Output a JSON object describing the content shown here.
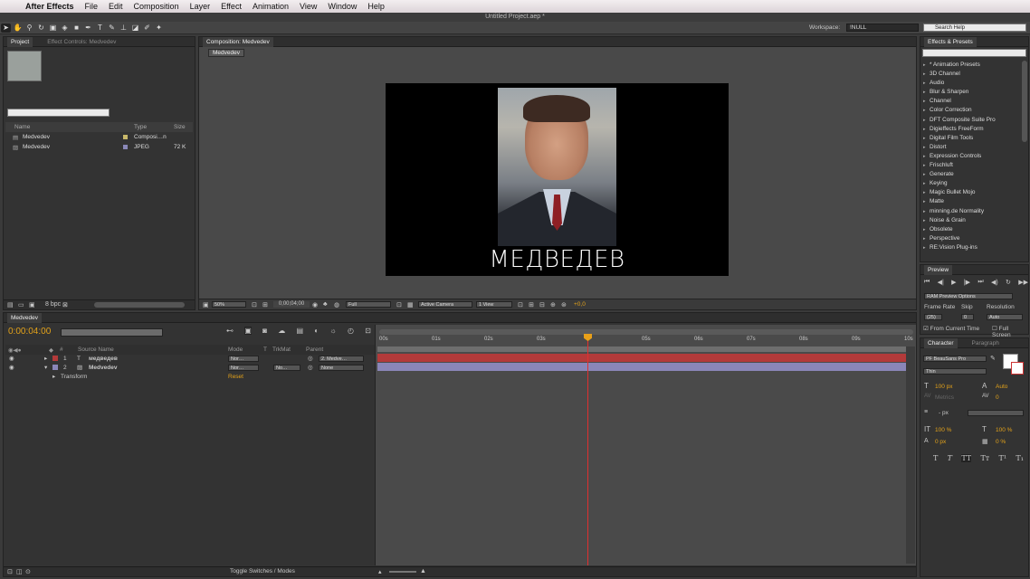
{
  "menu": {
    "app": "After Effects",
    "items": [
      "File",
      "Edit",
      "Composition",
      "Layer",
      "Effect",
      "Animation",
      "View",
      "Window",
      "Help"
    ]
  },
  "window_title": "Untitled Project.aep *",
  "workspace": {
    "label": "Workspace:",
    "value": "!NULL"
  },
  "search_help": "Search Help",
  "project": {
    "tab": "Project",
    "effect_controls_tab": "Effect Controls: Medvedev",
    "columns": {
      "name": "Name",
      "type": "Type",
      "size": "Size"
    },
    "items": [
      {
        "name": "Medvedev",
        "type": "Composi…n",
        "size": ""
      },
      {
        "name": "Medvedev",
        "type": "JPEG",
        "size": "72 K"
      }
    ],
    "bpc": "8 bpc"
  },
  "composition": {
    "tab": "Composition: Medvedev",
    "sub_tab": "Medvedev",
    "caption": "МЕДВЕДЕВ",
    "footer": {
      "zoom": "50%",
      "time": "0;00;04;00",
      "resolution": "Full",
      "camera": "Active Camera",
      "view": "1 View",
      "exposure": "+0,0"
    }
  },
  "effects": {
    "tab": "Effects & Presets",
    "items": [
      "* Animation Presets",
      "3D Channel",
      "Audio",
      "Blur & Sharpen",
      "Channel",
      "Color Correction",
      "DFT Composite Suite Pro",
      "Digieffects FreeForm",
      "Digital Film Tools",
      "Distort",
      "Expression Controls",
      "Frischluft",
      "Generate",
      "Keying",
      "Magic Bullet Mojo",
      "Matte",
      "minning.de Normality",
      "Noise & Grain",
      "Obsolete",
      "Perspective",
      "RE:Vision Plug-ins"
    ]
  },
  "preview": {
    "tab": "Preview",
    "ram_options": "RAM Preview Options",
    "frame_rate_label": "Frame Rate",
    "skip_label": "Skip",
    "resolution_label": "Resolution",
    "frame_rate": "(25)",
    "skip": "0",
    "resolution": "Auto",
    "from_current": "From Current Time",
    "full_screen": "Full Screen"
  },
  "character": {
    "tab": "Character",
    "paragraph_tab": "Paragraph",
    "font": "PF BeauSans Pro",
    "style": "Thin",
    "size": "100 px",
    "leading": "Auto",
    "kerning": "Metrics",
    "tracking": "0",
    "stroke": "- px",
    "vscale": "100 %",
    "hscale": "100 %",
    "baseline": "0 px",
    "tsume": "0 %"
  },
  "timeline": {
    "tab": "Medvedev",
    "timecode": "0:00:04:00",
    "columns": {
      "source": "Source Name",
      "mode": "Mode",
      "t": "T",
      "trkmat": "TrkMat",
      "parent": "Parent"
    },
    "layers": [
      {
        "num": "1",
        "name": "медведев",
        "mode": "Nor…",
        "trk": "",
        "parent": "2. Medve…"
      },
      {
        "num": "2",
        "name": "Medvedev",
        "mode": "Nor…",
        "trk": "No…",
        "parent": "None"
      }
    ],
    "transform": "Transform",
    "reset": "Reset",
    "ticks": [
      "00s",
      "01s",
      "02s",
      "03s",
      "",
      "05s",
      "06s",
      "07s",
      "08s",
      "09s",
      "10s"
    ],
    "toggle": "Toggle Switches / Modes",
    "colors": {
      "layer1": "#b33a3a",
      "layer2": "#8a86b8",
      "cti": "#e8a019"
    }
  }
}
